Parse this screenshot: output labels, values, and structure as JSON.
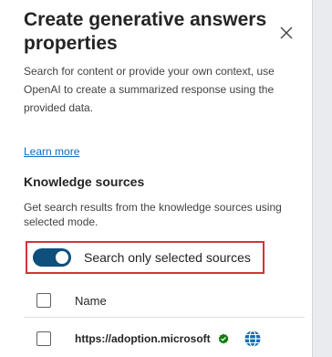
{
  "dialog": {
    "title": "Create generative answers properties",
    "description": "Search for content or provide your own context, use OpenAI to create a summarized response using the provided data.",
    "learn_more": "Learn more"
  },
  "knowledge": {
    "heading": "Knowledge sources",
    "description": "Get search results from the knowledge sources using selected mode.",
    "toggle_label": "Search only selected sources",
    "toggle_on": true
  },
  "table": {
    "column_name": "Name",
    "rows": [
      {
        "name": "https://adoption.microsoft",
        "checked": false
      }
    ]
  },
  "icons": {
    "close": "close-icon",
    "verified": "verified-check-icon",
    "globe": "globe-icon"
  },
  "colors": {
    "toggle_on": "#0e4f7c",
    "link": "#0f6cbd",
    "highlight_border": "#d13438",
    "verified": "#107c10",
    "globe": "#0f6cbd"
  }
}
